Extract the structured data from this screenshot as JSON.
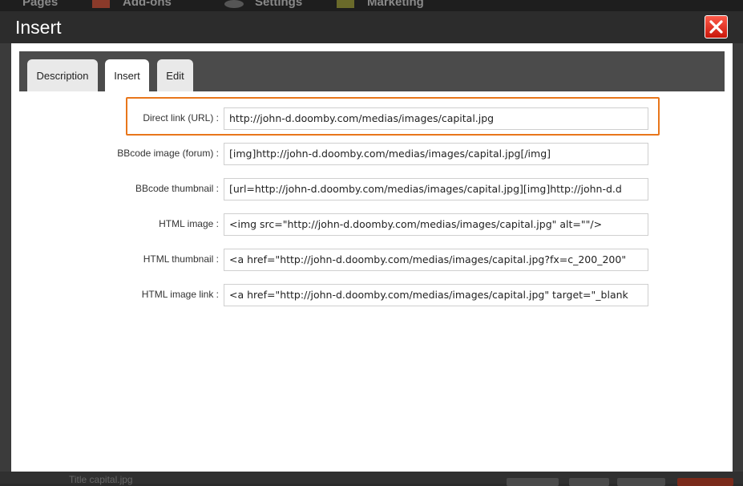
{
  "background": {
    "nav": [
      "Pages",
      "Add-ons",
      "Settings",
      "Marketing"
    ],
    "bottom_text": "Title capital.jpg"
  },
  "modal": {
    "title": "Insert",
    "close_icon": "close-icon"
  },
  "tabs": [
    {
      "label": "Description",
      "active": false
    },
    {
      "label": "Insert",
      "active": true
    },
    {
      "label": "Edit",
      "active": false
    }
  ],
  "rows": [
    {
      "label": "Direct link (URL) :",
      "value": "http://john-d.doomby.com/medias/images/capital.jpg",
      "highlighted": true
    },
    {
      "label": "BBcode image (forum) :",
      "value": "[img]http://john-d.doomby.com/medias/images/capital.jpg[/img]"
    },
    {
      "label": "BBcode thumbnail :",
      "value": "[url=http://john-d.doomby.com/medias/images/capital.jpg][img]http://john-d.d"
    },
    {
      "label": "HTML image :",
      "value": "<img src=\"http://john-d.doomby.com/medias/images/capital.jpg\" alt=\"\"/>"
    },
    {
      "label": "HTML thumbnail :",
      "value": "<a href=\"http://john-d.doomby.com/medias/images/capital.jpg?fx=c_200_200\""
    },
    {
      "label": "HTML image link :",
      "value": "<a href=\"http://john-d.doomby.com/medias/images/capital.jpg\" target=\"_blank"
    }
  ],
  "colors": {
    "highlight": "#e8761b",
    "close_button": "#d9281a"
  }
}
